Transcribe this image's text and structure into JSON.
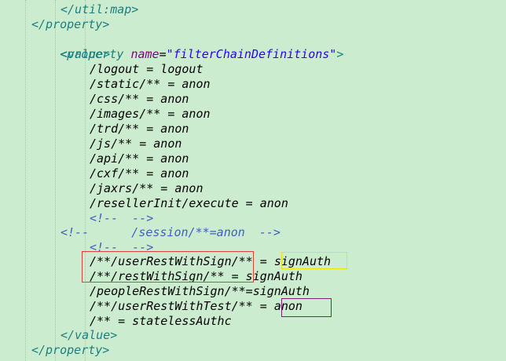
{
  "code": {
    "util_map_close": "</util:map>",
    "property_close_1": "</property>",
    "property_open_tag": "<property",
    "attr_name": "name",
    "attr_eq": "=",
    "attr_value": "\"filterChainDefinitions\"",
    "property_open_end": ">",
    "value_open": "<value>",
    "line_logout": "/logout = logout",
    "line_static": "/static/** = anon",
    "line_css": "/css/** = anon",
    "line_images": "/images/** = anon",
    "line_trd": "/trd/** = anon",
    "line_js": "/js/** = anon",
    "line_api": "/api/** = anon",
    "line_cxf": "/cxf/** = anon",
    "line_jaxrs": "/jaxrs/** = anon",
    "line_reseller": "/resellerInit/execute = anon",
    "comment_empty_1": "<!--  -->",
    "comment_session": "<!--      /session/**=anon  -->",
    "comment_empty_2": "<!--  -->",
    "line_userRestWithSign_path": "/**/userRestWithSign/** = ",
    "line_userRestWithSign_value": "signAuth",
    "line_restWithSign": "/**/restWithSign/** = signAuth",
    "line_peopleRestWithSign": "/peopleRestWithSign/**=signAuth",
    "line_userRestWithTest_path": "/**/userRestWithTest/** = ",
    "line_userRestWithTest_value": "anon",
    "line_stateless": "/** = statelessAuthc",
    "value_close": "</value>",
    "property_close_2": "</property>"
  },
  "colors": {
    "background": "#cceccf",
    "tag": "#1c7f7f",
    "attribute": "#7f007f",
    "string": "#2a00ff",
    "comment": "#3f5fbf",
    "highlight_red": "#e0403a",
    "highlight_yellow": "#e8e600",
    "highlight_purple": "#7a1f7a"
  }
}
